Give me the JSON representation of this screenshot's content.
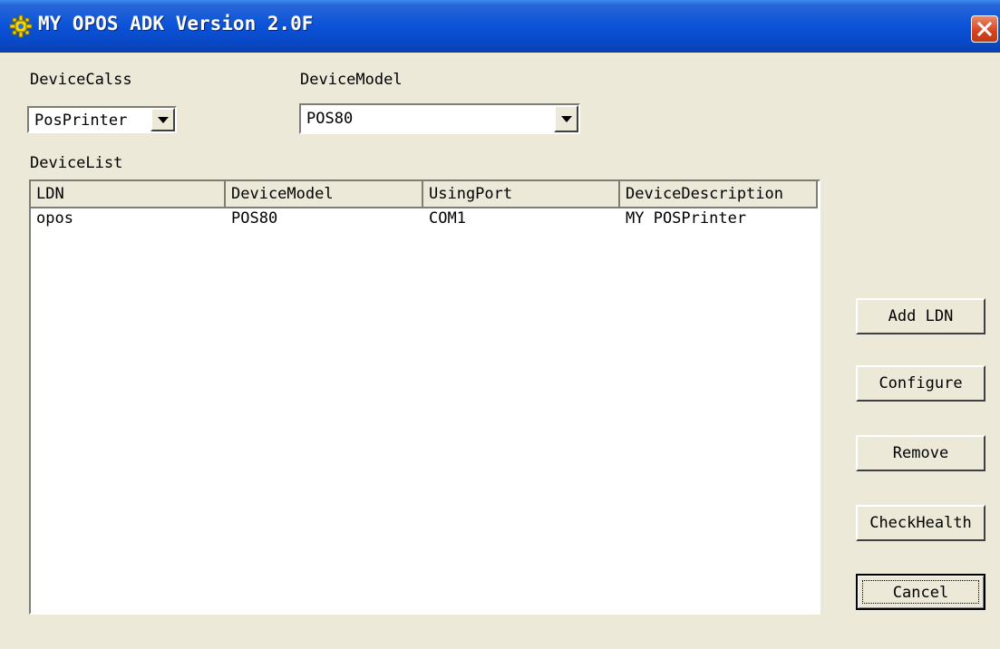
{
  "window": {
    "title": "MY OPOS ADK Version 2.0F"
  },
  "labels": {
    "device_class": "DeviceCalss",
    "device_model": "DeviceModel",
    "device_list": "DeviceList"
  },
  "device_class_combo": {
    "value": "PosPrinter"
  },
  "device_model_combo": {
    "value": "POS80"
  },
  "table": {
    "columns": [
      "LDN",
      "DeviceModel",
      "UsingPort",
      "DeviceDescription"
    ],
    "rows": [
      [
        "opos",
        "POS80",
        "COM1",
        "MY POSPrinter"
      ]
    ]
  },
  "buttons": {
    "add_ldn": "Add LDN",
    "configure": "Configure",
    "remove": "Remove",
    "check_health": "CheckHealth",
    "cancel": "Cancel"
  }
}
